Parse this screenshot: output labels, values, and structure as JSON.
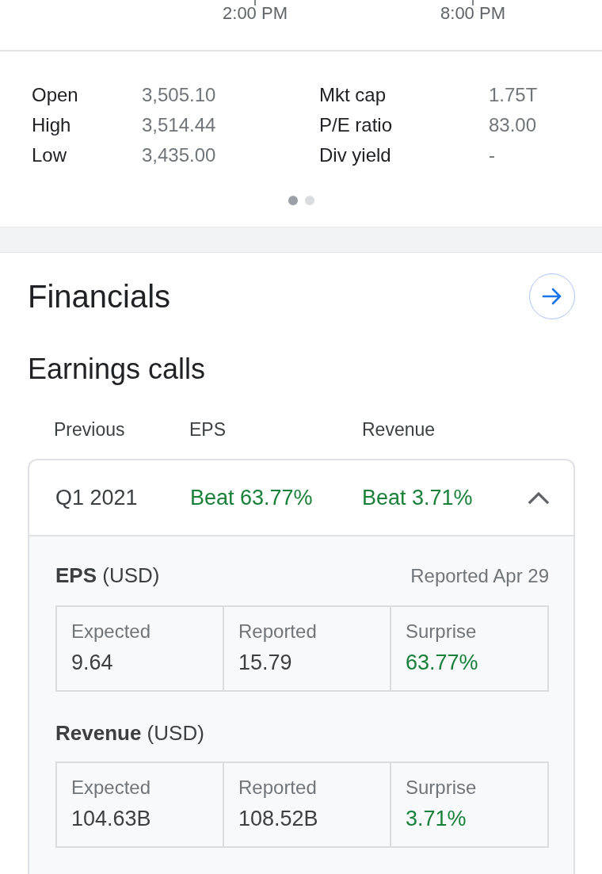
{
  "chart_axis": {
    "x_labels": [
      "2:00 PM",
      "8:00 PM"
    ]
  },
  "stats": {
    "columns": [
      [
        {
          "label": "Open",
          "value": "3,505.10"
        },
        {
          "label": "High",
          "value": "3,514.44"
        },
        {
          "label": "Low",
          "value": "3,435.00"
        }
      ],
      [
        {
          "label": "Mkt cap",
          "value": "1.75T"
        },
        {
          "label": "P/E ratio",
          "value": "83.00"
        },
        {
          "label": "Div yield",
          "value": "-"
        }
      ]
    ]
  },
  "pager": {
    "dots": [
      {
        "selected": true
      },
      {
        "selected": false
      }
    ]
  },
  "financials": {
    "title": "Financials",
    "earnings_calls": {
      "title": "Earnings calls",
      "columns": [
        "Previous",
        "EPS",
        "Revenue"
      ],
      "rows": [
        {
          "quarter": "Q1 2021",
          "eps": {
            "text": "Beat 63.77%",
            "kind": "positive"
          },
          "revenue": {
            "text": "Beat 3.71%",
            "kind": "positive"
          },
          "expanded": true,
          "details": [
            {
              "title": "**EPS** (USD)",
              "note": "Reported Apr 29",
              "cells": [
                {
                  "label": "Expected",
                  "value": "9.64",
                  "kind": "neutral"
                },
                {
                  "label": "Reported",
                  "value": "15.79",
                  "kind": "neutral"
                },
                {
                  "label": "Surprise",
                  "value": "63.77%",
                  "kind": "positive"
                }
              ]
            },
            {
              "title": "**Revenue** (USD)",
              "cells": [
                {
                  "label": "Expected",
                  "value": "104.63B",
                  "kind": "neutral"
                },
                {
                  "label": "Reported",
                  "value": "108.52B",
                  "kind": "neutral"
                },
                {
                  "label": "Surprise",
                  "value": "3.71%",
                  "kind": "positive"
                }
              ]
            }
          ]
        }
      ]
    }
  }
}
